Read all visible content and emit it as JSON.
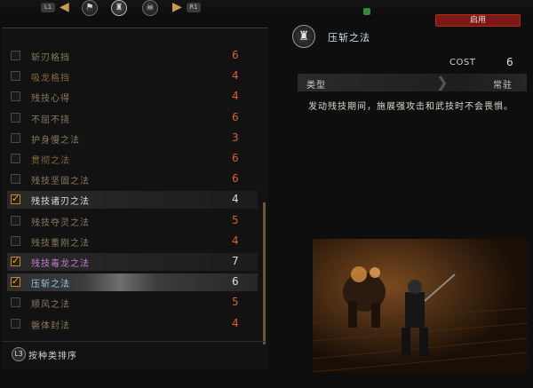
{
  "nav": {
    "left_key": "L1",
    "right_key": "R1",
    "icons": [
      "flag-emblem-icon",
      "samurai-helmet-icon",
      "oni-mask-icon"
    ],
    "active_icon_index": 1
  },
  "enable_button": {
    "label": "启用"
  },
  "skills": [
    {
      "name": "斩刃格挡",
      "cost": "6",
      "checked": false,
      "color": "#8a7a5f",
      "cost_color": "#d9612e"
    },
    {
      "name": "吸龙格挡",
      "cost": "4",
      "checked": false,
      "color": "#8a6a3a",
      "cost_color": "#d9612e"
    },
    {
      "name": "残技心得",
      "cost": "4",
      "checked": false,
      "color": "#8a7a5f",
      "cost_color": "#d9612e"
    },
    {
      "name": "不屈不挠",
      "cost": "6",
      "checked": false,
      "color": "#8a7a5f",
      "cost_color": "#d9612e"
    },
    {
      "name": "护身慢之法",
      "cost": "3",
      "checked": false,
      "color": "#8a7a5f",
      "cost_color": "#d9612e"
    },
    {
      "name": "贯彻之法",
      "cost": "6",
      "checked": false,
      "color": "#8a6a3a",
      "cost_color": "#d9612e"
    },
    {
      "name": "残技坚固之法",
      "cost": "6",
      "checked": false,
      "color": "#8a7a5f",
      "cost_color": "#d9612e"
    },
    {
      "name": "残技诸刃之法",
      "cost": "4",
      "checked": true,
      "color": "#e3ddd1",
      "cost_color": "#e3ddd1"
    },
    {
      "name": "残技夺灵之法",
      "cost": "5",
      "checked": false,
      "color": "#8a7a5f",
      "cost_color": "#d9612e"
    },
    {
      "name": "残技重刚之法",
      "cost": "4",
      "checked": false,
      "color": "#8a7a5f",
      "cost_color": "#d9612e"
    },
    {
      "name": "残技毒龙之法",
      "cost": "7",
      "checked": true,
      "color": "#c77ad6",
      "cost_color": "#e3ddd1"
    },
    {
      "name": "压斩之法",
      "cost": "6",
      "checked": true,
      "color": "#8fc8e6",
      "cost_color": "#e3ddd1"
    },
    {
      "name": "顺风之法",
      "cost": "5",
      "checked": false,
      "color": "#8a7a5f",
      "cost_color": "#d9612e"
    },
    {
      "name": "磐体封法",
      "cost": "4",
      "checked": false,
      "color": "#8a7a5f",
      "cost_color": "#d9612e"
    }
  ],
  "selected_index": 11,
  "highlighted_indices": [
    7,
    10
  ],
  "sort": {
    "label": "按种类排序",
    "key": "L3"
  },
  "detail": {
    "title": "压斩之法",
    "cost_label": "COST",
    "cost_value": "6",
    "type_label": "类型",
    "type_value": "常驻",
    "description": "发动残技期间，施展强攻击和武技时不会畏惧。"
  }
}
